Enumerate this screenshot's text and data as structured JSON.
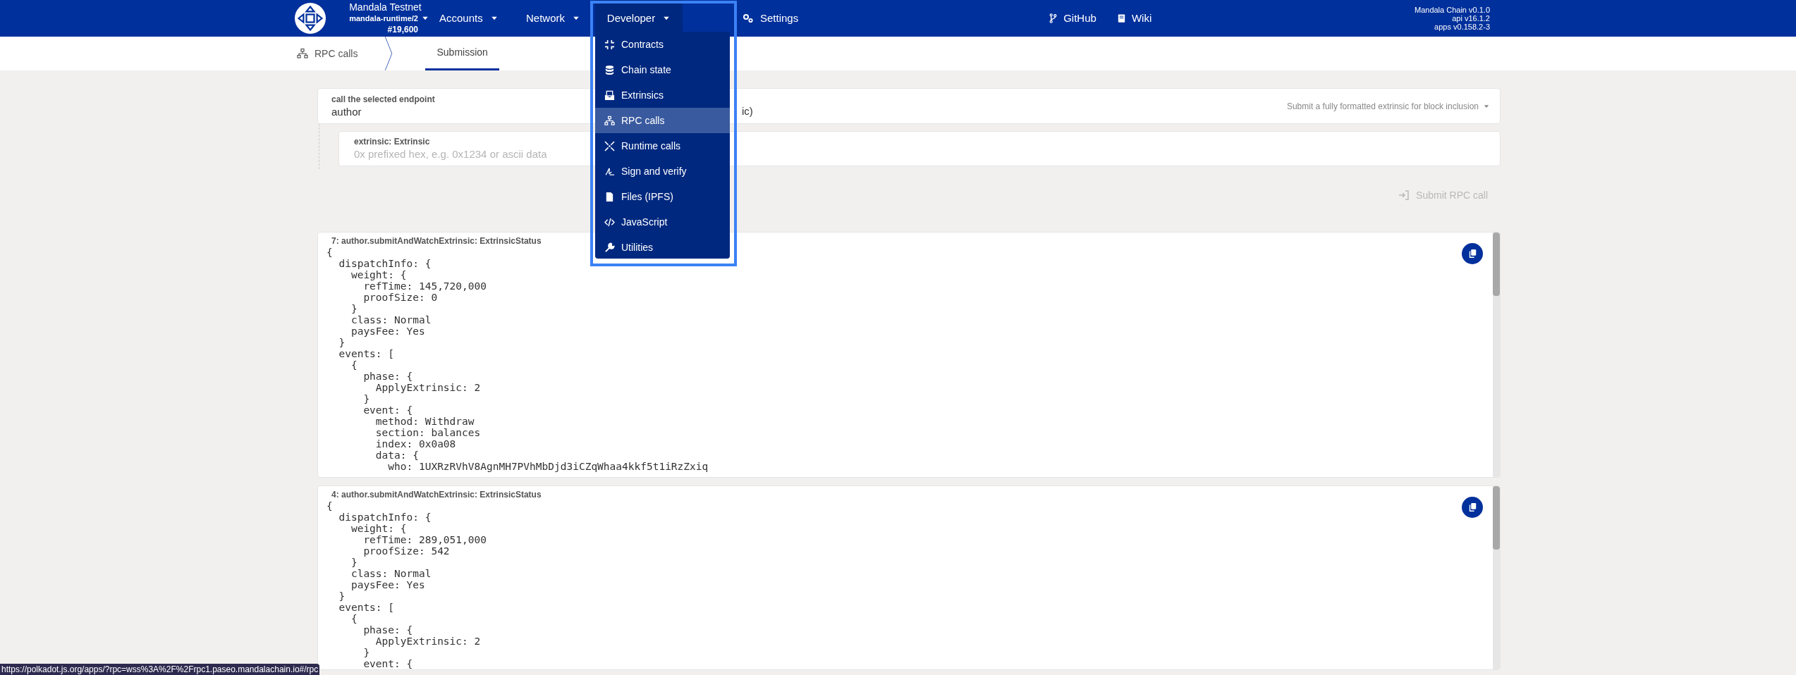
{
  "header": {
    "chain_name": "Mandala Testnet",
    "runtime": "mandala-runtime/2",
    "block": "#19,600",
    "nav": [
      {
        "label": "Accounts",
        "kind": "dropdown",
        "selected": false
      },
      {
        "label": "Network",
        "kind": "dropdown",
        "selected": false
      },
      {
        "label": "Developer",
        "kind": "dropdown",
        "selected": true
      },
      {
        "label": "Settings",
        "kind": "link",
        "selected": false
      }
    ],
    "links": [
      {
        "label": "GitHub"
      },
      {
        "label": "Wiki"
      }
    ],
    "versions": [
      "Mandala Chain v0.1.0",
      "api v16.1.2",
      "apps v0.158.2-3"
    ]
  },
  "developer_menu": {
    "items": [
      {
        "label": "Contracts",
        "selected": false
      },
      {
        "label": "Chain state",
        "selected": false
      },
      {
        "label": "Extrinsics",
        "selected": false
      },
      {
        "label": "RPC calls",
        "selected": true
      },
      {
        "label": "Runtime calls",
        "selected": false
      },
      {
        "label": "Sign and verify",
        "selected": false
      },
      {
        "label": "Files (IPFS)",
        "selected": false
      },
      {
        "label": "JavaScript",
        "selected": false
      },
      {
        "label": "Utilities",
        "selected": false
      }
    ]
  },
  "subnav": {
    "section": "RPC calls",
    "tabs": [
      {
        "label": "Submission",
        "selected": true
      }
    ]
  },
  "form": {
    "endpoint_label": "call the selected endpoint",
    "module": "author",
    "method_visible": "ic)",
    "method_hint": "Submit a fully formatted extrinsic for block inclusion",
    "param_label": "extrinsic: Extrinsic",
    "param_placeholder": "0x prefixed hex, e.g. 0x1234 or ascii data",
    "submit": {
      "label": "Submit RPC call",
      "disabled": true
    }
  },
  "results": [
    {
      "title": "7: author.submitAndWatchExtrinsic: ExtrinsicStatus",
      "lines": [
        "{",
        "  dispatchInfo: {",
        "    weight: {",
        "      refTime: 145,720,000",
        "      proofSize: 0",
        "    }",
        "    class: Normal",
        "    paysFee: Yes",
        "  }",
        "  events: [",
        "    {",
        "      phase: {",
        "        ApplyExtrinsic: 2",
        "      }",
        "      event: {",
        "        method: Withdraw",
        "        section: balances",
        "        index: 0x0a08",
        "        data: {",
        "          who: 1UXRzRVhV8AgnMH7PVhMbDjd3iCZqWhaa4kkf5t1iRzZxiq"
      ]
    },
    {
      "title": "4: author.submitAndWatchExtrinsic: ExtrinsicStatus",
      "lines": [
        "{",
        "  dispatchInfo: {",
        "    weight: {",
        "      refTime: 289,051,000",
        "      proofSize: 542",
        "    }",
        "    class: Normal",
        "    paysFee: Yes",
        "  }",
        "  events: [",
        "    {",
        "      phase: {",
        "        ApplyExtrinsic: 2",
        "      }",
        "      event: {"
      ]
    }
  ],
  "status_url": "https://polkadot.js.org/apps/?rpc=wss%3A%2F%2Frpc1.paseo.mandalachain.io#/rpc"
}
